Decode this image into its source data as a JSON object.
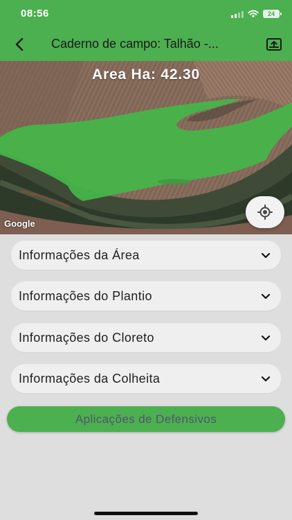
{
  "status_bar": {
    "time": "08:56",
    "battery_level": "24",
    "icons": [
      "signal-icon",
      "wifi-icon",
      "battery-icon"
    ]
  },
  "header": {
    "title": "Caderno de campo: Talhão -...",
    "back_icon": "chevron-left-icon",
    "export_icon": "share-upload-icon"
  },
  "map": {
    "area_label": "Area Ha: 42.30",
    "attribution": "Google",
    "locate_icon": "my-location-icon"
  },
  "sections": [
    {
      "label": "Informações da Área"
    },
    {
      "label": "Informações do Plantio"
    },
    {
      "label": "Informações do Cloreto"
    },
    {
      "label": "Informações da Colheita"
    }
  ],
  "action": {
    "label": "Aplicações de Defensivos"
  },
  "colors": {
    "primary": "#4caf50",
    "background": "#dedede",
    "panel": "#efefef",
    "field_overlay": "#45b649"
  }
}
